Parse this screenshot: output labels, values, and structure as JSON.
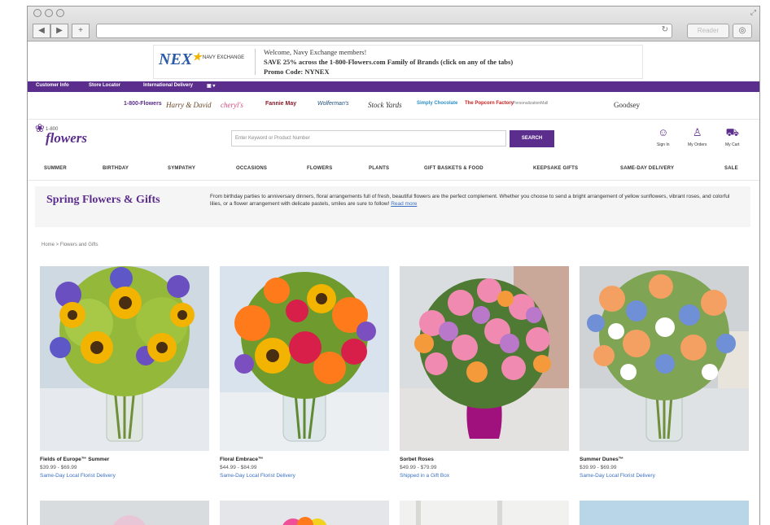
{
  "promo": {
    "logo": "NEX",
    "logo_sub": "NAVY EXCHANGE",
    "line1": "Welcome, Navy Exchange members!",
    "line2": "SAVE 25% across the 1-800-Flowers.com Family of Brands (click on any of the tabs)",
    "line3": "Promo Code: NYNEX"
  },
  "top_bar": {
    "customer_info": "Customer Info",
    "store_locator": "Store Locator",
    "international": "International Delivery"
  },
  "brands": [
    "1-800-Flowers",
    "Harry & David",
    "cheryl's",
    "Fannie May",
    "Wolferman's",
    "Stock Yards",
    "Simply Chocolate",
    "The Popcorn Factory",
    "PersonalizationMall",
    "Goodsey"
  ],
  "header": {
    "logo_small": "1-800",
    "logo_text": "flowers",
    "search_placeholder": "Enter Keyword or Product Number",
    "search_button": "SEARCH",
    "sign_in": "Sign In",
    "my_orders": "My Orders",
    "cart": "My Cart"
  },
  "categories": [
    "SUMMER",
    "BIRTHDAY",
    "SYMPATHY",
    "OCCASIONS",
    "FLOWERS",
    "PLANTS",
    "GIFT BASKETS & FOOD",
    "KEEPSAKE GIFTS",
    "SAME-DAY DELIVERY",
    "SALE"
  ],
  "intro": {
    "title": "Spring Flowers & Gifts",
    "text": "From birthday parties to anniversary dinners, floral arrangements full of fresh, beautiful flowers are the perfect complement. Whether you choose to send a bright arrangement of yellow sunflowers, vibrant roses, and colorful lilies, or a flower arrangement with delicate pastels, smiles are sure to follow!",
    "read_more": "Read more"
  },
  "breadcrumb": "Home  >  Flowers and Gifts",
  "products": [
    {
      "name": "Fields of Europe™ Summer",
      "price": "$39.99 - $69.99",
      "delivery": "Same-Day Local Florist Delivery"
    },
    {
      "name": "Floral Embrace™",
      "price": "$44.99 - $84.99",
      "delivery": "Same-Day Local Florist Delivery"
    },
    {
      "name": "Sorbet Roses",
      "price": "$49.99 - $79.99",
      "delivery": "Shipped in a Gift Box"
    },
    {
      "name": "Summer Dunes™",
      "price": "$39.99 - $69.99",
      "delivery": "Same-Day Local Florist Delivery"
    }
  ]
}
